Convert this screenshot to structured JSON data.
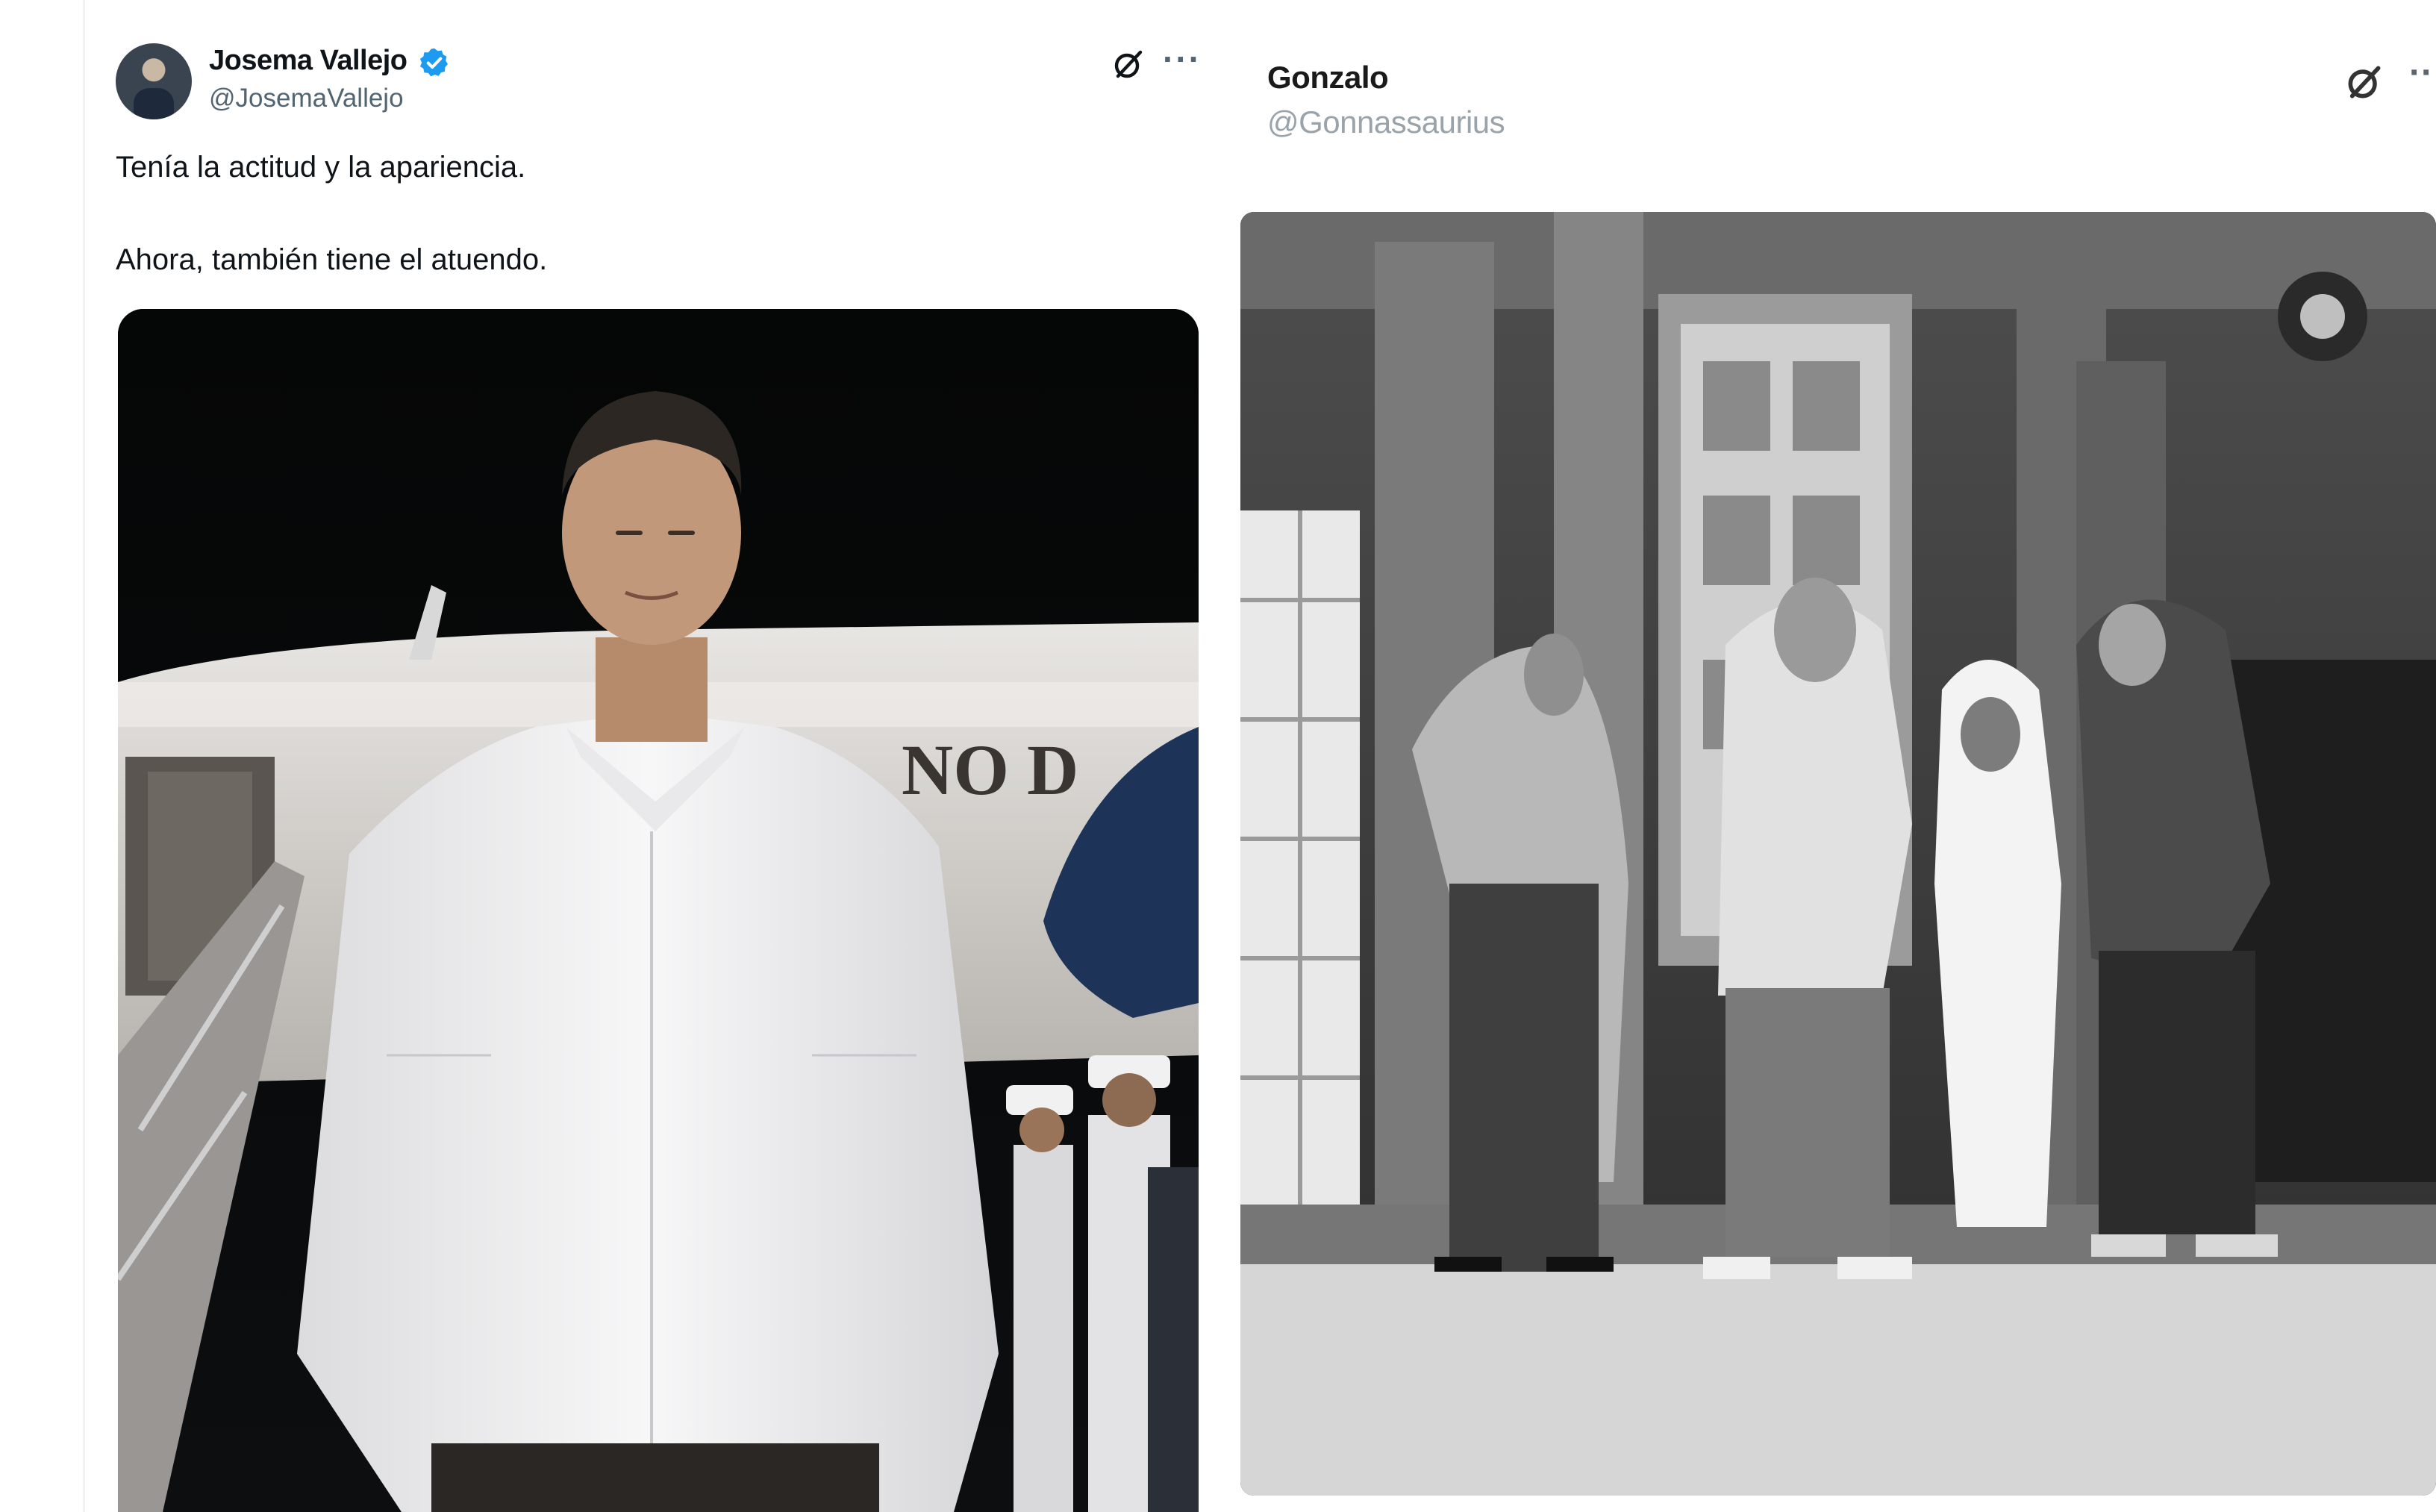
{
  "left_tweet": {
    "author_name": "Josema Vallejo",
    "handle": "@JosemaVallejo",
    "verified": true,
    "text_line_1": "Tenía la actitud y la apariencia.",
    "text_line_2": "Ahora, también tiene el atuendo.",
    "image_partial_text": "NO D",
    "icons": [
      "grok-icon",
      "more-icon",
      "verified-badge-icon"
    ]
  },
  "right_tweet": {
    "author_name": "Gonzalo",
    "handle": "@Gonnassaurius",
    "icons": [
      "grok-icon",
      "more-icon"
    ]
  },
  "colors": {
    "accent_verified": "#1d9bf0",
    "text_primary": "#0f1419",
    "text_secondary": "#536471"
  }
}
